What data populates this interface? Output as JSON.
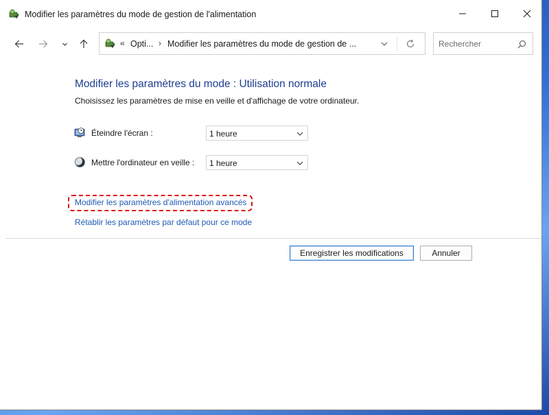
{
  "window": {
    "title": "Modifier les paramètres du mode de gestion de l'alimentation",
    "icon": "power-options-icon"
  },
  "nav": {
    "address": {
      "overflow": "«",
      "segment1": "Opti...",
      "separator": "›",
      "segment2": "Modifier les paramètres du mode de gestion de ..."
    },
    "search_placeholder": "Rechercher"
  },
  "content": {
    "title": "Modifier les paramètres du mode : Utilisation normale",
    "subtitle": "Choisissez les paramètres de mise en veille et d'affichage de votre ordinateur.",
    "settings": [
      {
        "label": "Éteindre l'écran :",
        "value": "1 heure",
        "icon": "display-clock-icon"
      },
      {
        "label": "Mettre l'ordinateur en veille :",
        "value": "1 heure",
        "icon": "sleep-moon-icon"
      }
    ],
    "links": {
      "advanced": "Modifier les paramètres d'alimentation avancés",
      "restore": "Rétablir les paramètres par défaut pour ce mode"
    },
    "buttons": {
      "save": "Enregistrer les modifications",
      "cancel": "Annuler"
    }
  },
  "colors": {
    "title_blue": "#1e3d8f",
    "link_blue": "#1f5bb3",
    "highlight_red": "#e01010"
  }
}
